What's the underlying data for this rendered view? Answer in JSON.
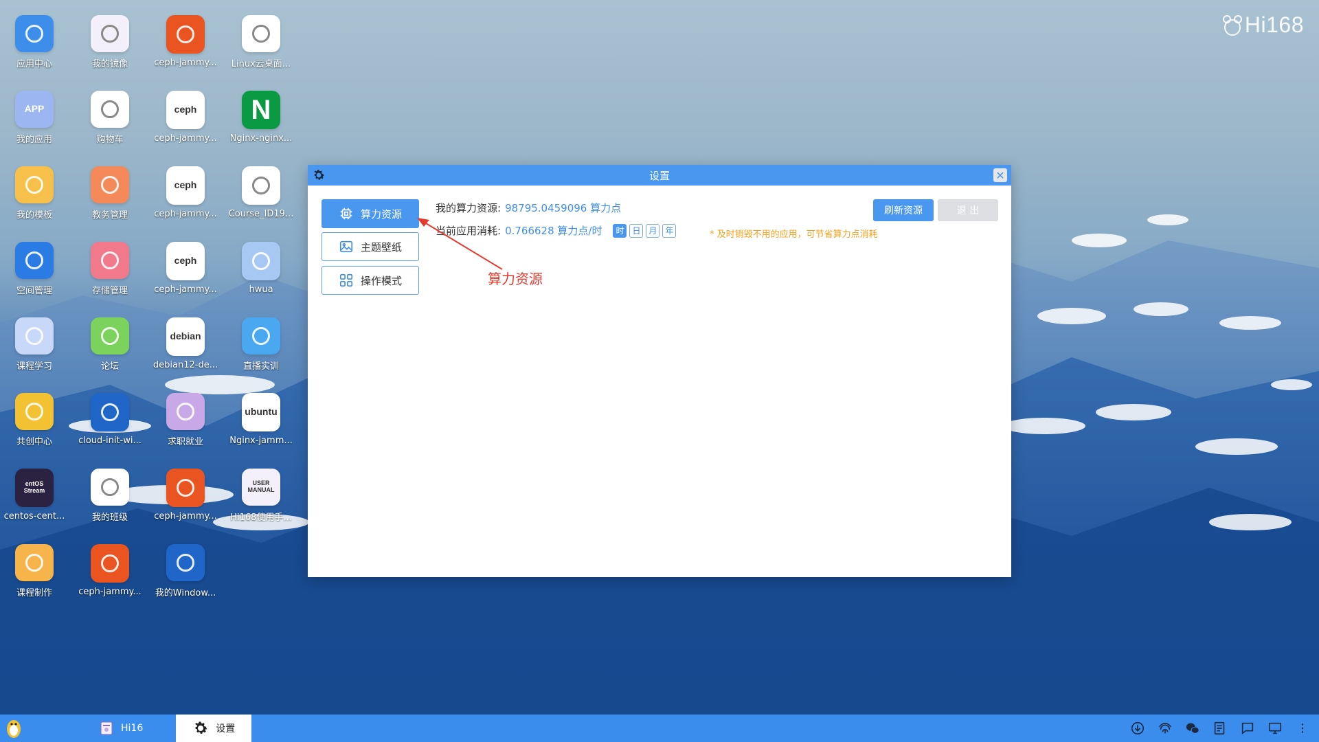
{
  "brand": {
    "logo_text": "Hi168"
  },
  "desktop_icons": [
    {
      "label": "应用中心",
      "icon": "app-center-icon",
      "color": "#3d8eea"
    },
    {
      "label": "我的镜像",
      "icon": "mirror-icon",
      "color": "#f4f0fb"
    },
    {
      "label": "ceph-jammy...",
      "icon": "ubuntu-icon",
      "color": "#e95420"
    },
    {
      "label": "Linux云桌面...",
      "icon": "linux-penguin-icon",
      "color": "#ffffff"
    },
    {
      "label": "我的应用",
      "icon": "my-apps-icon",
      "color": "#9bb6f0",
      "badge": "APP"
    },
    {
      "label": "购物车",
      "icon": "shopping-cart-icon",
      "color": "#ffffff"
    },
    {
      "label": "ceph-jammy...",
      "icon": "ceph-icon",
      "color": "#ffffff",
      "badge": "ceph"
    },
    {
      "label": "Nginx-nginx...",
      "icon": "nginx-icon",
      "color": "#0b9a44",
      "badge": "N"
    },
    {
      "label": "我的模板",
      "icon": "folder-icon",
      "color": "#f6c04a"
    },
    {
      "label": "教务管理",
      "icon": "academic-icon",
      "color": "#f48a5a"
    },
    {
      "label": "ceph-jammy...",
      "icon": "ceph-icon",
      "color": "#ffffff",
      "badge": "ceph"
    },
    {
      "label": "Course_ID19...",
      "icon": "linux-penguin-icon",
      "color": "#ffffff"
    },
    {
      "label": "空间管理",
      "icon": "space-icon",
      "color": "#2a7be4"
    },
    {
      "label": "存储管理",
      "icon": "storage-icon",
      "color": "#f07a8c"
    },
    {
      "label": "ceph-jammy...",
      "icon": "ceph-icon",
      "color": "#ffffff",
      "badge": "ceph"
    },
    {
      "label": "hwua",
      "icon": "paint-icon",
      "color": "#a8c8f4"
    },
    {
      "label": "课程学习",
      "icon": "course-study-icon",
      "color": "#c8d8f8"
    },
    {
      "label": "论坛",
      "icon": "forum-icon",
      "color": "#7bd25c"
    },
    {
      "label": "debian12-de...",
      "icon": "debian-icon",
      "color": "#ffffff",
      "badge": "debian"
    },
    {
      "label": "直播实训",
      "icon": "live-icon",
      "color": "#4aa8f0"
    },
    {
      "label": "共创中心",
      "icon": "cocreate-icon",
      "color": "#f2c232"
    },
    {
      "label": "cloud-init-wi...",
      "icon": "windows-icon",
      "color": "#1f66c8"
    },
    {
      "label": "求职就业",
      "icon": "job-icon",
      "color": "#c9a8e8"
    },
    {
      "label": "Nginx-jamm...",
      "icon": "ubuntu-logo-icon",
      "color": "#ffffff",
      "badge": "ubuntu"
    },
    {
      "label": "centos-cent...",
      "icon": "centos-icon",
      "color": "#2b2140",
      "badge": "entOS Stream"
    },
    {
      "label": "我的班级",
      "icon": "class-icon",
      "color": "#ffffff"
    },
    {
      "label": "ceph-jammy...",
      "icon": "ubuntu-icon",
      "color": "#e95420"
    },
    {
      "label": "Hi168使用手...",
      "icon": "manual-icon",
      "color": "#f4f0fb",
      "badge": "USER MANUAL"
    },
    {
      "label": "课程制作",
      "icon": "course-make-icon",
      "color": "#f6b44a"
    },
    {
      "label": "ceph-jammy...",
      "icon": "ubuntu-icon",
      "color": "#e95420"
    },
    {
      "label": "我的Window...",
      "icon": "windows-icon",
      "color": "#1f66c8"
    }
  ],
  "dialog": {
    "title": "设置",
    "tabs": [
      {
        "label": "算力资源",
        "icon": "chip-icon",
        "active": true
      },
      {
        "label": "主题壁纸",
        "icon": "image-icon",
        "active": false
      },
      {
        "label": "操作模式",
        "icon": "grid-icon",
        "active": false
      }
    ],
    "resource_label": "我的算力资源:",
    "resource_value": "98795.0459096 算力点",
    "consumption_label": "当前应用消耗:",
    "consumption_value": "0.766628 算力点/时",
    "periods": [
      {
        "label": "时",
        "active": true
      },
      {
        "label": "日",
        "active": false
      },
      {
        "label": "月",
        "active": false
      },
      {
        "label": "年",
        "active": false
      }
    ],
    "tip": "* 及时销毁不用的应用，可节省算力点消耗",
    "refresh_label": "刷新资源",
    "exit_label": "退 出",
    "annotation": "算力资源"
  },
  "taskbar": {
    "items": [
      {
        "label": "Hi16",
        "active": false,
        "icon": "manual-icon"
      },
      {
        "label": "设置",
        "active": true,
        "icon": "gear-icon"
      }
    ],
    "tray": [
      "download-icon",
      "fingerprint-icon",
      "wechat-icon",
      "notes-icon",
      "chat-icon",
      "monitor-icon",
      "more-icon"
    ]
  }
}
